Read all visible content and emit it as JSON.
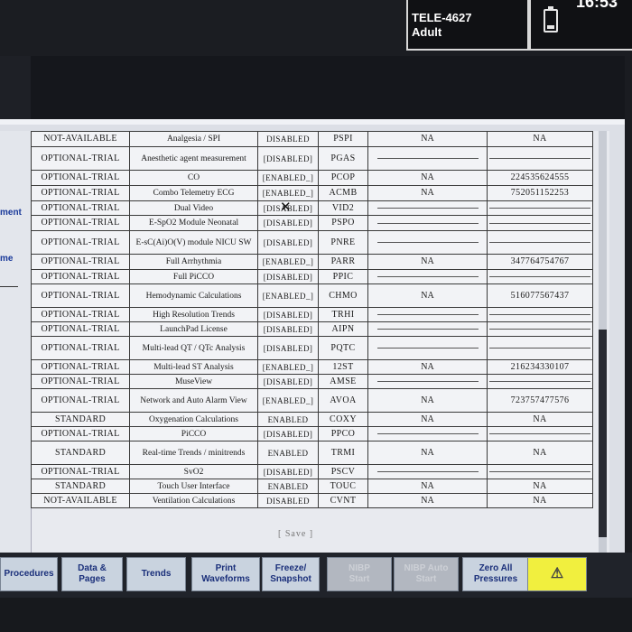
{
  "header": {
    "bed_label": "TELE-4627",
    "patient_type": "Adult",
    "time": "16:53"
  },
  "sidebar": {
    "partial_label_1": "ment",
    "partial_label_2": "me"
  },
  "table": {
    "rows": [
      {
        "type": "NOT-AVAILABLE",
        "name": "Analgesia / SPI",
        "status": "DISABLED",
        "code": "PSPI",
        "na": "NA",
        "serial": "NA"
      },
      {
        "type": "OPTIONAL-TRIAL",
        "name": "Anesthetic agent measurement",
        "status": "[DISABLED]",
        "code": "PGAS",
        "na": "",
        "serial": ""
      },
      {
        "type": "OPTIONAL-TRIAL",
        "name": "CO",
        "status": "[ENABLED_]",
        "code": "PCOP",
        "na": "NA",
        "serial": "224535624555"
      },
      {
        "type": "OPTIONAL-TRIAL",
        "name": "Combo Telemetry ECG",
        "status": "[ENABLED_]",
        "code": "ACMB",
        "na": "NA",
        "serial": "752051152253"
      },
      {
        "type": "OPTIONAL-TRIAL",
        "name": "Dual Video",
        "status": "[DISABLED]",
        "code": "VID2",
        "na": "",
        "serial": ""
      },
      {
        "type": "OPTIONAL-TRIAL",
        "name": "E-SpO2 Module Neonatal",
        "status": "[DISABLED]",
        "code": "PSPO",
        "na": "",
        "serial": ""
      },
      {
        "type": "OPTIONAL-TRIAL",
        "name": "E-sC(Ai)O(V) module NICU SW",
        "status": "[DISABLED]",
        "code": "PNRE",
        "na": "",
        "serial": ""
      },
      {
        "type": "OPTIONAL-TRIAL",
        "name": "Full Arrhythmia",
        "status": "[ENABLED_]",
        "code": "PARR",
        "na": "NA",
        "serial": "347764754767"
      },
      {
        "type": "OPTIONAL-TRIAL",
        "name": "Full PiCCO",
        "status": "[DISABLED]",
        "code": "PPIC",
        "na": "",
        "serial": ""
      },
      {
        "type": "OPTIONAL-TRIAL",
        "name": "Hemodynamic Calculations",
        "status": "[ENABLED_]",
        "code": "CHMO",
        "na": "NA",
        "serial": "516077567437"
      },
      {
        "type": "OPTIONAL-TRIAL",
        "name": "High Resolution Trends",
        "status": "[DISABLED]",
        "code": "TRHI",
        "na": "",
        "serial": ""
      },
      {
        "type": "OPTIONAL-TRIAL",
        "name": "LaunchPad License",
        "status": "[DISABLED]",
        "code": "AIPN",
        "na": "",
        "serial": ""
      },
      {
        "type": "OPTIONAL-TRIAL",
        "name": "Multi-lead QT / QTc Analysis",
        "status": "[DISABLED]",
        "code": "PQTC",
        "na": "",
        "serial": ""
      },
      {
        "type": "OPTIONAL-TRIAL",
        "name": "Multi-lead ST Analysis",
        "status": "[ENABLED_]",
        "code": "12ST",
        "na": "NA",
        "serial": "216234330107"
      },
      {
        "type": "OPTIONAL-TRIAL",
        "name": "MuseView",
        "status": "[DISABLED]",
        "code": "AMSE",
        "na": "",
        "serial": ""
      },
      {
        "type": "OPTIONAL-TRIAL",
        "name": "Network and Auto Alarm View",
        "status": "[ENABLED_]",
        "code": "AVOA",
        "na": "NA",
        "serial": "723757477576"
      },
      {
        "type": "STANDARD",
        "name": "Oxygenation Calculations",
        "status": "ENABLED",
        "code": "COXY",
        "na": "NA",
        "serial": "NA"
      },
      {
        "type": "OPTIONAL-TRIAL",
        "name": "PiCCO",
        "status": "[DISABLED]",
        "code": "PPCO",
        "na": "",
        "serial": ""
      },
      {
        "type": "STANDARD",
        "name": "Real-time Trends / minitrends",
        "status": "ENABLED",
        "code": "TRMI",
        "na": "NA",
        "serial": "NA"
      },
      {
        "type": "OPTIONAL-TRIAL",
        "name": "SvO2",
        "status": "[DISABLED]",
        "code": "PSCV",
        "na": "",
        "serial": ""
      },
      {
        "type": "STANDARD",
        "name": "Touch User Interface",
        "status": "ENABLED",
        "code": "TOUC",
        "na": "NA",
        "serial": "NA"
      },
      {
        "type": "NOT-AVAILABLE",
        "name": "Ventilation Calculations",
        "status": "DISABLED",
        "code": "CVNT",
        "na": "NA",
        "serial": "NA"
      }
    ]
  },
  "save_label": "[ Save ]",
  "buttons": [
    {
      "id": "procedures",
      "label": "Procedures",
      "enabled": true
    },
    {
      "id": "data-pages",
      "label": "Data &\nPages",
      "enabled": true
    },
    {
      "id": "trends",
      "label": "Trends",
      "enabled": true
    },
    {
      "id": "print-waveforms",
      "label": "Print\nWaveforms",
      "enabled": true
    },
    {
      "id": "freeze-snapshot",
      "label": "Freeze/\nSnapshot",
      "enabled": true
    },
    {
      "id": "nibp-start",
      "label": "NIBP\nStart",
      "enabled": false
    },
    {
      "id": "nibp-auto-start",
      "label": "NIBP Auto\nStart",
      "enabled": false
    },
    {
      "id": "zero-all-pressures",
      "label": "Zero All\nPressures",
      "enabled": true
    },
    {
      "id": "alarm-silence",
      "label": "⚠",
      "enabled": true
    }
  ]
}
